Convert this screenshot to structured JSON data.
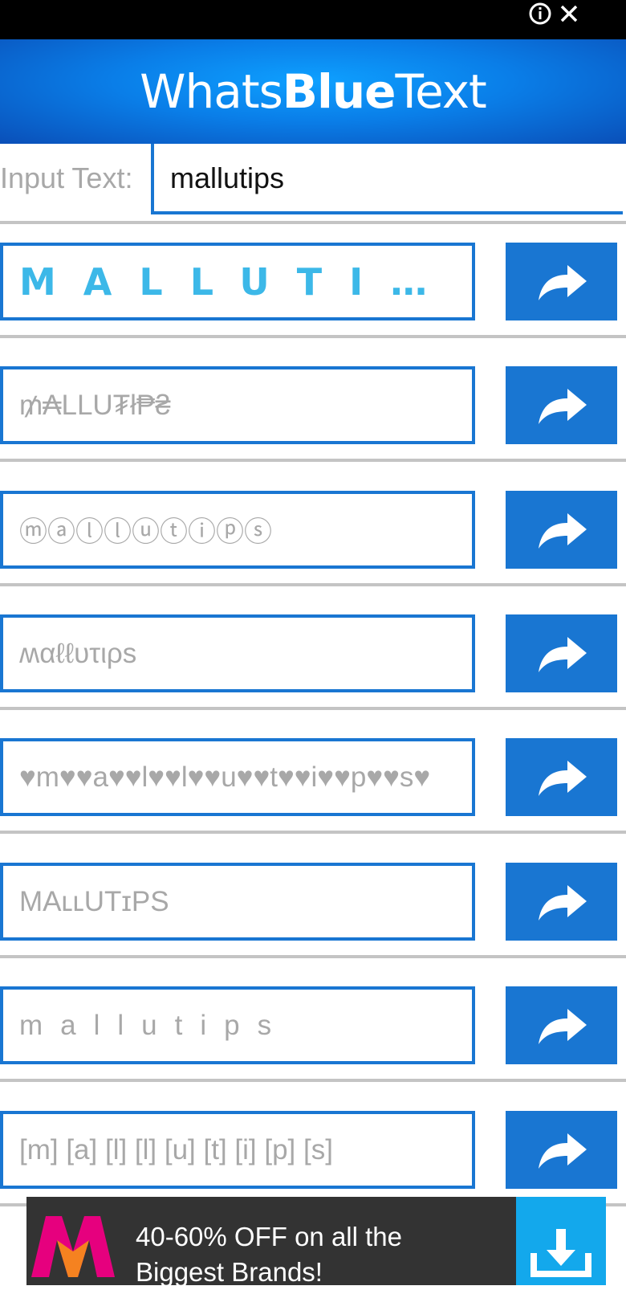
{
  "app": {
    "title_light_1": "Whats",
    "title_bold": "Blue",
    "title_light_2": "Text"
  },
  "input": {
    "label": "Input Text:",
    "value": "mallutips"
  },
  "results": [
    {
      "text": "MALLUTIPS"
    },
    {
      "text": "₥₳LLU₮ł₱₴"
    },
    {
      "text": "ⓜⓐⓛⓛⓤⓣⓘⓟⓢ"
    },
    {
      "text": "ʍαℓℓυτιρs"
    },
    {
      "text": "♥m♥♥a♥♥l♥♥l♥♥u♥♥t♥♥i♥♥p♥♥s♥"
    },
    {
      "text": "MAʟʟUTɪPS"
    },
    {
      "text": "mallutips"
    },
    {
      "text": "[m] [a] [l] [l] [u] [t] [i] [p] [s]"
    }
  ],
  "ad": {
    "line1": "40-60% OFF on all the",
    "line2": "Biggest Brands!",
    "colors": {
      "background": "#333333",
      "cta": "#13a8ec",
      "logo_pink": "#e6007e",
      "logo_orange": "#f58220"
    }
  },
  "icons": {
    "share": "share-arrow-icon",
    "info": "info-icon",
    "close": "close-icon",
    "download": "download-icon",
    "brand_logo": "myntra-logo-icon"
  },
  "colors": {
    "accent": "#1976d2",
    "header_gradient": [
      "#0ea0ff",
      "#0a4fb8"
    ],
    "divider": "#c4c4c4",
    "placeholder_text": "#a8a8a8",
    "first_style_text": "#3cb8e8"
  }
}
